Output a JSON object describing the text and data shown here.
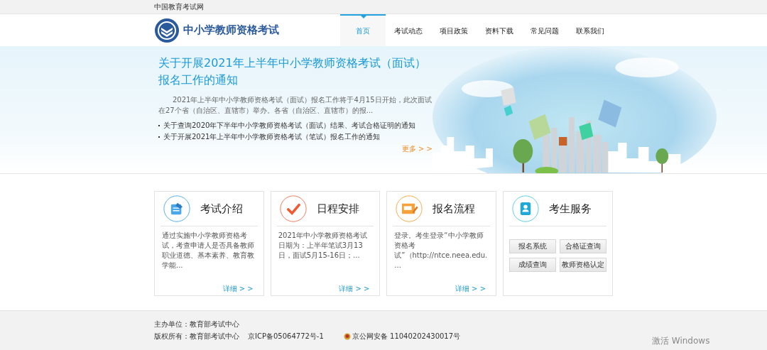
{
  "top_bar": {
    "site_name": "中国教育考试网"
  },
  "header": {
    "logo_text": "中小学教师资格考试"
  },
  "nav": [
    {
      "label": "首页",
      "selected": true
    },
    {
      "label": "考试动态",
      "selected": false
    },
    {
      "label": "项目政策",
      "selected": false
    },
    {
      "label": "资料下载",
      "selected": false
    },
    {
      "label": "常见问题",
      "selected": false
    },
    {
      "label": "联系我们",
      "selected": false
    }
  ],
  "banner": {
    "headline": "关于开展2021年上半年中小学教师资格考试（面试）报名工作的通知",
    "summary": "2021年上半年中小学教师资格考试（面试）报名工作将于4月15日开始，此次面试在27个省（自治区、直辖市）举办。各省（自治区、直辖市）的报...",
    "links": [
      "关于查询2020年下半年中小学教师资格考试（面试）结果、考试合格证明的通知",
      "关于开展2021年上半年中小学教师资格考试（笔试）报名工作的通知"
    ],
    "more": "更多 > >"
  },
  "cards": [
    {
      "kind": "text",
      "title": "考试介绍",
      "body": "通过实施中小学教师资格考试，考查申请人是否具备教师职业道德、基本素养、教育教学能...",
      "more": "详细 > >"
    },
    {
      "kind": "text",
      "title": "日程安排",
      "body": "2021年中小学教师资格考试日期为：上半年笔试3月13日，面试5月15-16日；...",
      "more": "详细 > >"
    },
    {
      "kind": "text",
      "title": "报名流程",
      "body": "登录。考生登录“中小学教师资格考试”（http://ntce.neea.edu....",
      "more": "详细 > >"
    },
    {
      "kind": "services",
      "title": "考生服务",
      "buttons": [
        "报名系统",
        "合格证查询",
        "成绩查询",
        "教师资格认定"
      ]
    }
  ],
  "footer": {
    "sponsor": "主办单位：教育部考试中心",
    "copyright": "版权所有：教育部考试中心",
    "icp": "京ICP备05064772号-1",
    "police": "京公网安备 11040202430017号"
  },
  "os_overlay": {
    "activation": "激活 Windows"
  }
}
